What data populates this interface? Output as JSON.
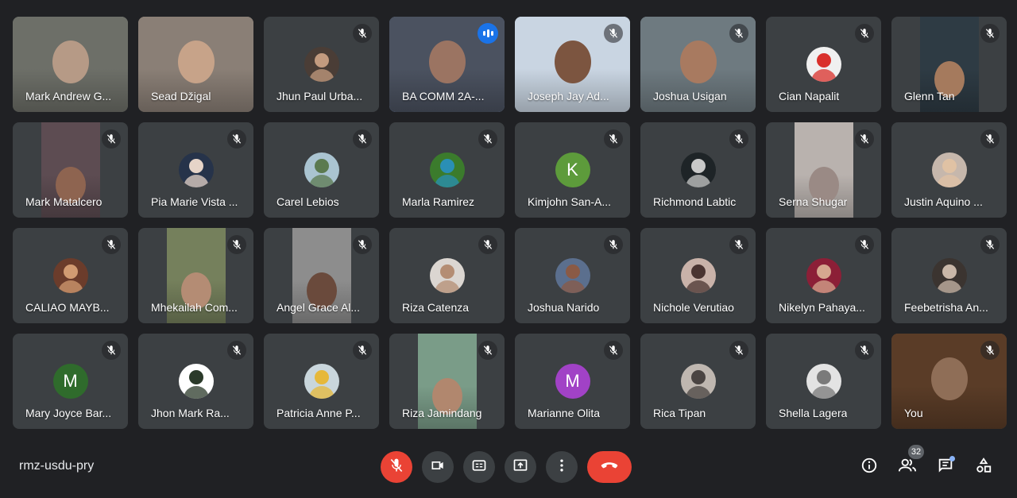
{
  "meeting": {
    "code": "rmz-usdu-pry",
    "participant_count": "32"
  },
  "colors": {
    "background": "#202124",
    "tile": "#3c4043",
    "speaking_outline": "#8ab4f8",
    "leave_red": "#ea4335"
  },
  "icons": {
    "mic_off": "mic-off-icon",
    "speaking": "speaking-indicator-icon",
    "camera": "videocam-icon",
    "captions": "closed-captions-icon",
    "present": "present-screen-icon",
    "more": "more-vert-icon",
    "leave": "call-end-icon",
    "info": "info-icon",
    "people": "people-icon",
    "chat": "chat-icon",
    "activities": "activities-icon"
  },
  "participants": [
    {
      "name": "Mark Andrew G...",
      "display": "video",
      "muted": false,
      "bg": "#6d6f68",
      "face": "#b69a86"
    },
    {
      "name": "Sead Džigal",
      "display": "video",
      "muted": false,
      "bg": "#8a7f76",
      "face": "#c7a389"
    },
    {
      "name": "Jhun Paul Urba...",
      "display": "avatar",
      "muted": true,
      "avatar_bg": "#4a3d36",
      "avatar_fg": "#c39b7f"
    },
    {
      "name": "BA COMM 2A-...",
      "display": "video",
      "muted": false,
      "speaking": true,
      "bg": "#4b5260",
      "face": "#9b7462"
    },
    {
      "name": "Joseph Jay Ad...",
      "display": "video",
      "muted": true,
      "bg": "#c9d5e2",
      "face": "#7c5540"
    },
    {
      "name": "Joshua Usigan",
      "display": "video",
      "muted": true,
      "bg": "#6e7a80",
      "face": "#a87a60"
    },
    {
      "name": "Cian Napalit",
      "display": "avatar",
      "muted": true,
      "avatar_bg": "#f0f0f0",
      "avatar_fg": "#d9302b"
    },
    {
      "name": "Glenn Tan",
      "display": "video-narrow",
      "muted": true,
      "bg": "#2e3b44",
      "face": "#a57a5d"
    },
    {
      "name": "Mark Matalcero",
      "display": "video-narrow",
      "muted": true,
      "bg": "#5d4c52",
      "face": "#8e6450"
    },
    {
      "name": "Pia Marie Vista ...",
      "display": "avatar",
      "muted": true,
      "avatar_bg": "#26334a",
      "avatar_fg": "#e6d4c8"
    },
    {
      "name": "Carel Lebios",
      "display": "avatar",
      "muted": true,
      "avatar_bg": "#aac4d1",
      "avatar_fg": "#5b7a4f"
    },
    {
      "name": "Marla Ramirez",
      "display": "avatar",
      "muted": true,
      "avatar_bg": "#3b7b2c",
      "avatar_fg": "#2a8fb5"
    },
    {
      "name": "Kimjohn San-A...",
      "display": "initial",
      "muted": true,
      "initial": "K",
      "avatar_bg": "#5d9b3b"
    },
    {
      "name": "Richmond Labtic",
      "display": "avatar",
      "muted": true,
      "avatar_bg": "#1e2427",
      "avatar_fg": "#c9c9c9"
    },
    {
      "name": "Serna Shugar",
      "display": "video-narrow",
      "muted": true,
      "bg": "#b9b2ae",
      "face": "#9a8a85"
    },
    {
      "name": "Justin Aquino ...",
      "display": "avatar",
      "muted": true,
      "avatar_bg": "#c6b7ac",
      "avatar_fg": "#e0c2a4"
    },
    {
      "name": "CALIAO MAYB...",
      "display": "avatar",
      "muted": true,
      "avatar_bg": "#6b3c2b",
      "avatar_fg": "#d19b72"
    },
    {
      "name": "Mhekailah Com...",
      "display": "video-narrow",
      "muted": true,
      "bg": "#75805c",
      "face": "#b48c74"
    },
    {
      "name": "Angel Grace Al...",
      "display": "video-narrow",
      "muted": true,
      "bg": "#8d8d8d",
      "face": "#6a4a3c"
    },
    {
      "name": "Riza Catenza",
      "display": "avatar",
      "muted": true,
      "avatar_bg": "#dbd6d1",
      "avatar_fg": "#b48d73"
    },
    {
      "name": "Joshua Narido",
      "display": "avatar",
      "muted": true,
      "avatar_bg": "#5b6f8e",
      "avatar_fg": "#8a5a45"
    },
    {
      "name": "Nichole Verutiao",
      "display": "avatar",
      "muted": true,
      "avatar_bg": "#c9b2a9",
      "avatar_fg": "#4a3431"
    },
    {
      "name": "Nikelyn Pahaya...",
      "display": "avatar",
      "muted": true,
      "avatar_bg": "#8c1f37",
      "avatar_fg": "#d6a78f"
    },
    {
      "name": "Feebetrisha An...",
      "display": "avatar",
      "muted": true,
      "avatar_bg": "#3b3430",
      "avatar_fg": "#c9b7a8"
    },
    {
      "name": "Mary Joyce Bar...",
      "display": "initial",
      "muted": true,
      "initial": "M",
      "avatar_bg": "#2f6b2c"
    },
    {
      "name": "Jhon Mark Ra...",
      "display": "avatar",
      "muted": true,
      "avatar_bg": "#ffffff",
      "avatar_fg": "#2b3a2a"
    },
    {
      "name": "Patricia Anne P...",
      "display": "avatar",
      "muted": true,
      "avatar_bg": "#c9d6dc",
      "avatar_fg": "#e6b83a"
    },
    {
      "name": "Riza Jamindang",
      "display": "video-narrow",
      "muted": true,
      "bg": "#7a9c88",
      "face": "#b1876e"
    },
    {
      "name": "Marianne Olita",
      "display": "initial",
      "muted": true,
      "initial": "M",
      "avatar_bg": "#a142c6"
    },
    {
      "name": "Rica Tipan",
      "display": "avatar",
      "muted": true,
      "avatar_bg": "#bfb7b0",
      "avatar_fg": "#4a4442"
    },
    {
      "name": "Shella Lagera",
      "display": "avatar",
      "muted": true,
      "avatar_bg": "#e3e3e3",
      "avatar_fg": "#7a7a7a"
    },
    {
      "name": "You",
      "display": "video",
      "muted": true,
      "self": true,
      "bg": "#5a3c27",
      "face": "#8f6e57"
    }
  ]
}
